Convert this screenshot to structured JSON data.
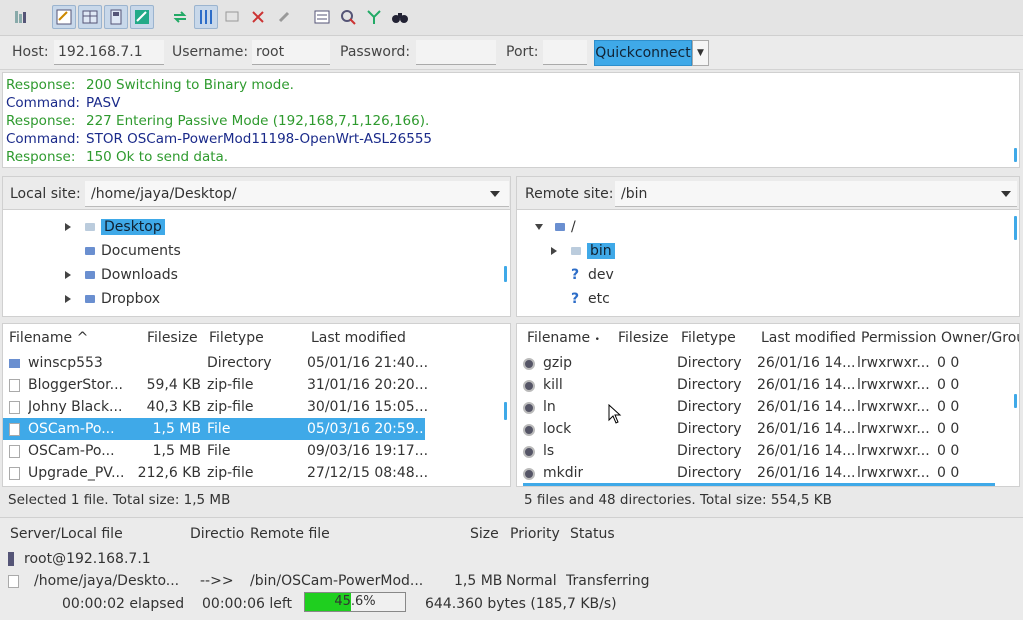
{
  "toolbar": {
    "buttons": [
      "site-manager-icon",
      "message-log-icon",
      "local-tree-icon",
      "remote-tree-icon",
      "transfer-queue-icon",
      "refresh-icon",
      "process-queue-icon",
      "cancel-icon",
      "disconnect-icon",
      "reconnect-icon",
      "dir-listing-filter-icon",
      "compare-icon",
      "sync-browse-icon",
      "search-icon"
    ]
  },
  "quickconnect": {
    "host_label": "Host:",
    "host_value": "192.168.7.1",
    "username_label": "Username:",
    "username_value": "root",
    "password_label": "Password:",
    "password_value": "",
    "port_label": "Port:",
    "port_value": "",
    "button_label": "Quickconnect"
  },
  "log": [
    {
      "kind": "Response:",
      "text": "200 Switching to Binary mode.",
      "type": "resp"
    },
    {
      "kind": "Command:",
      "text": "PASV",
      "type": "cmd"
    },
    {
      "kind": "Response:",
      "text": "227 Entering Passive Mode (192,168,7,1,126,166).",
      "type": "resp"
    },
    {
      "kind": "Command:",
      "text": "STOR OSCam-PowerMod11198-OpenWrt-ASL26555",
      "type": "cmd"
    },
    {
      "kind": "Response:",
      "text": "150 Ok to send data.",
      "type": "resp"
    }
  ],
  "local": {
    "site_label": "Local site:",
    "path": "/home/jaya/Desktop/",
    "tree": [
      {
        "label": "Desktop",
        "expander": true,
        "selected": true
      },
      {
        "label": "Documents",
        "expander": false,
        "selected": false
      },
      {
        "label": "Downloads",
        "expander": true,
        "selected": false
      },
      {
        "label": "Dropbox",
        "expander": true,
        "selected": false
      }
    ],
    "headers": {
      "filename": "Filename",
      "filesize": "Filesize",
      "filetype": "Filetype",
      "modified": "Last modified"
    },
    "files": [
      {
        "name": "winscp553",
        "size": "",
        "type": "Directory",
        "modified": "05/01/16 21:40...",
        "icon": "dir"
      },
      {
        "name": "BloggerStor...",
        "size": "59,4 KB",
        "type": "zip-file",
        "modified": "31/01/16 20:20...",
        "icon": "file"
      },
      {
        "name": "Johny Black...",
        "size": "40,3 KB",
        "type": "zip-file",
        "modified": "30/01/16 15:05...",
        "icon": "file"
      },
      {
        "name": "OSCam-Po...",
        "size": "1,5 MB",
        "type": "File",
        "modified": "05/03/16 20:59...",
        "icon": "file",
        "selected": true
      },
      {
        "name": "OSCam-Po...",
        "size": "1,5 MB",
        "type": "File",
        "modified": "09/03/16 19:17...",
        "icon": "file"
      },
      {
        "name": "Upgrade_PV...",
        "size": "212,6 KB",
        "type": "zip-file",
        "modified": "27/12/15 08:48...",
        "icon": "file"
      }
    ],
    "status": "Selected 1 file. Total size: 1,5 MB"
  },
  "remote": {
    "site_label": "Remote site:",
    "path": "/bin",
    "tree": [
      {
        "label": "/",
        "expander": "down",
        "selected": false,
        "icon": "dir"
      },
      {
        "label": "bin",
        "expander": "right",
        "selected": true,
        "icon": "dir"
      },
      {
        "label": "dev",
        "expander": "",
        "selected": false,
        "icon": "unknown"
      },
      {
        "label": "etc",
        "expander": "",
        "selected": false,
        "icon": "unknown"
      }
    ],
    "headers": {
      "filename": "Filename",
      "filesize": "Filesize",
      "filetype": "Filetype",
      "modified": "Last modified",
      "permissions": "Permission",
      "owner": "Owner/Grou"
    },
    "files": [
      {
        "name": "gzip",
        "type": "Directory",
        "modified": "26/01/16 14...",
        "perm": "lrwxrwxr...",
        "owner": "0 0"
      },
      {
        "name": "kill",
        "type": "Directory",
        "modified": "26/01/16 14...",
        "perm": "lrwxrwxr...",
        "owner": "0 0"
      },
      {
        "name": "ln",
        "type": "Directory",
        "modified": "26/01/16 14...",
        "perm": "lrwxrwxr...",
        "owner": "0 0"
      },
      {
        "name": "lock",
        "type": "Directory",
        "modified": "26/01/16 14...",
        "perm": "lrwxrwxr...",
        "owner": "0 0"
      },
      {
        "name": "ls",
        "type": "Directory",
        "modified": "26/01/16 14...",
        "perm": "lrwxrwxr...",
        "owner": "0 0"
      },
      {
        "name": "mkdir",
        "type": "Directory",
        "modified": "26/01/16 14...",
        "perm": "lrwxrwxr...",
        "owner": "0 0"
      }
    ],
    "status": "5 files and 48 directories. Total size: 554,5 KB"
  },
  "queue": {
    "headers": {
      "server": "Server/Local file",
      "direction": "Directio",
      "remote": "Remote file",
      "size": "Size",
      "priority": "Priority",
      "status": "Status"
    },
    "server": "root@192.168.7.1",
    "item": {
      "local": "/home/jaya/Deskto...",
      "direction": "-->>",
      "remote": "/bin/OSCam-PowerMod...",
      "size": "1,5 MB",
      "priority": "Normal",
      "status": "Transferring"
    },
    "elapsed": "00:00:02 elapsed",
    "left": "00:00:06 left",
    "progress_label": "45.6%",
    "progress_value": 0.456,
    "rate": "644.360 bytes (185,7 KB/s)"
  },
  "colors": {
    "accent": "#3fa9e8",
    "response": "#2e9a2e",
    "command": "#1a2a8a",
    "progress": "#1fcf1f"
  }
}
